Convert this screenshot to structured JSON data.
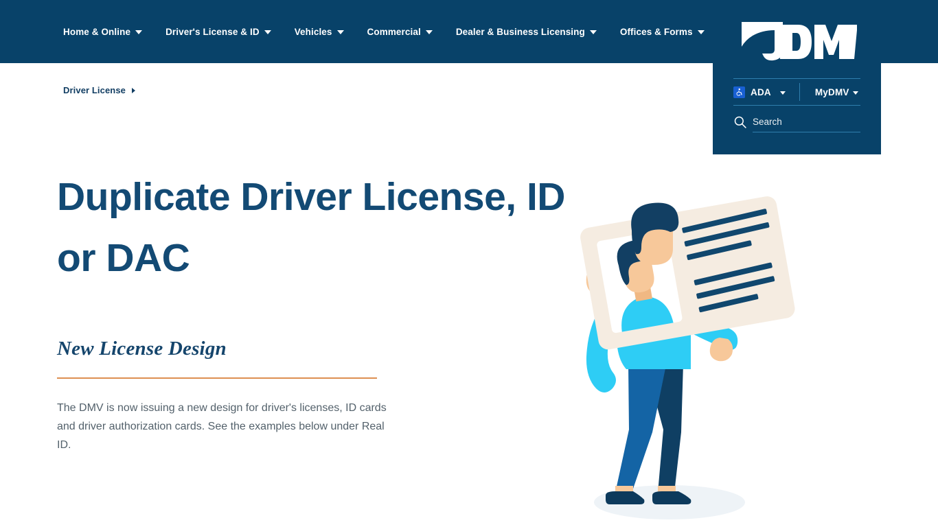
{
  "colors": {
    "header_navy": "#084269",
    "title_navy": "#134a74",
    "accent_orange": "#dd8f51",
    "ada_blue": "#1860d3",
    "body_gray": "#53616b",
    "illustration_cyan": "#2ecdf5",
    "illustration_card": "#f5ece1",
    "illustration_navy": "#123f63",
    "illustration_skin": "#f7c89a"
  },
  "header": {
    "nav_items": [
      {
        "label": "Home & Online",
        "has_dropdown": true
      },
      {
        "label": "Driver's License & ID",
        "has_dropdown": true
      },
      {
        "label": "Vehicles",
        "has_dropdown": true
      },
      {
        "label": "Commercial",
        "has_dropdown": true
      },
      {
        "label": "Dealer & Business Licensing",
        "has_dropdown": true
      },
      {
        "label": "Offices & Forms",
        "has_dropdown": true
      }
    ],
    "logo_text": "DMV",
    "logo_icon": "dmv-swoosh-logo"
  },
  "utility": {
    "ada_label": "ADA",
    "ada_icon": "wheelchair-accessibility-icon",
    "mydmv_label": "MyDMV",
    "search_icon": "search-icon",
    "search_placeholder": "Search",
    "search_value": ""
  },
  "breadcrumb": {
    "items": [
      {
        "label": "Driver License"
      }
    ],
    "separator_icon": "caret-right-icon"
  },
  "main": {
    "title": "Duplicate Driver License, ID or DAC",
    "subheading": "New License Design",
    "body": "The DMV is now issuing a new design for driver's licenses, ID cards and driver authorization cards. See the examples below under Real ID."
  },
  "illustration": {
    "name": "person-holding-id-card-illustration",
    "card_text_lines": 6,
    "has_portrait_photo": true
  }
}
